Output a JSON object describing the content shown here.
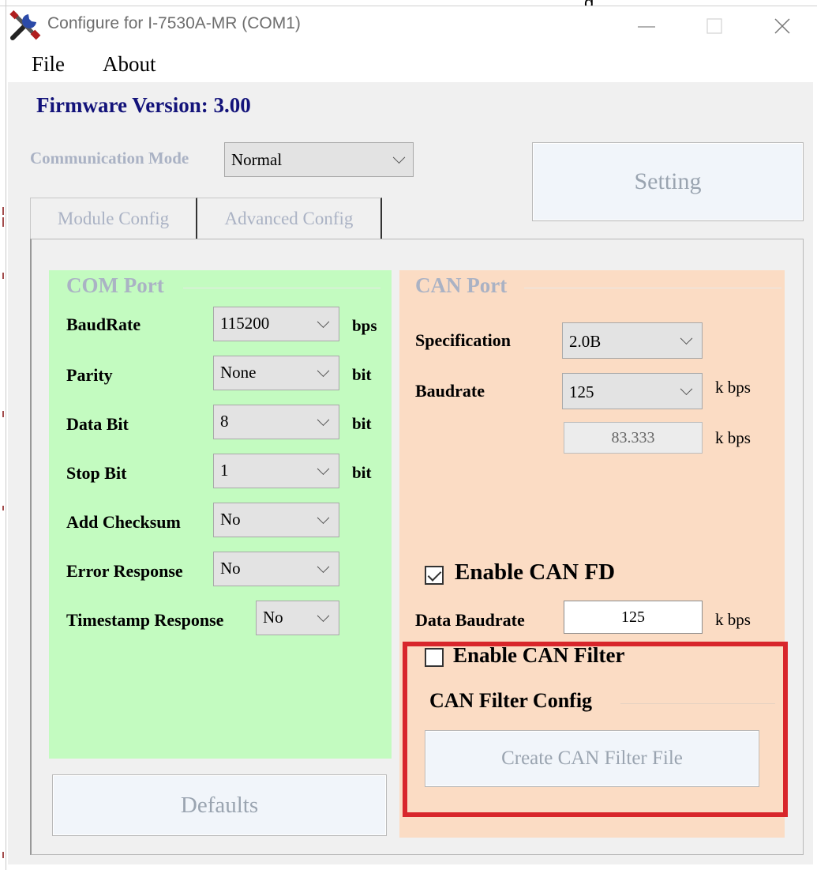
{
  "window": {
    "title": "Configure for I-7530A-MR (COM1)",
    "top_crop_text": "g"
  },
  "menu": {
    "items": [
      {
        "label": "File"
      },
      {
        "label": "About"
      }
    ]
  },
  "firmware": {
    "label": "Firmware Version: 3.00"
  },
  "comm_mode": {
    "label": "Communication Mode",
    "value": "Normal"
  },
  "setting_button": "Setting",
  "tabs": [
    {
      "label": "Module Config",
      "active": true
    },
    {
      "label": "Advanced Config",
      "active": false
    }
  ],
  "com_port": {
    "title": "COM Port",
    "rows": [
      {
        "label": "BaudRate",
        "value": "115200",
        "unit": "bps"
      },
      {
        "label": "Parity",
        "value": "None",
        "unit": "bit"
      },
      {
        "label": "Data Bit",
        "value": "8",
        "unit": "bit"
      },
      {
        "label": "Stop Bit",
        "value": "1",
        "unit": "bit"
      },
      {
        "label": "Add Checksum",
        "value": "No",
        "unit": ""
      },
      {
        "label": "Error Response",
        "value": "No",
        "unit": ""
      },
      {
        "label": "Timestamp Response",
        "value": "No",
        "unit": ""
      }
    ]
  },
  "defaults_button": "Defaults",
  "can_port": {
    "title": "CAN Port",
    "specification": {
      "label": "Specification",
      "value": "2.0B"
    },
    "baudrate": {
      "label": "Baudrate",
      "value": "125",
      "unit": "k bps"
    },
    "actual_baud": {
      "value": "83.333",
      "unit": "k bps"
    },
    "enable_can_fd": {
      "label": "Enable CAN FD",
      "checked": true
    },
    "data_baudrate": {
      "label": "Data Baudrate",
      "value": "125",
      "unit": "k bps"
    },
    "enable_can_filter": {
      "label": "Enable CAN Filter",
      "checked": false
    },
    "filter_config": {
      "title": "CAN Filter Config",
      "button": "Create CAN Filter File"
    }
  },
  "colors": {
    "com_group_bg": "#c3fbc0",
    "can_group_bg": "#fbdcc4",
    "highlight_border": "#d8262b",
    "firmware_text": "#13137a"
  }
}
